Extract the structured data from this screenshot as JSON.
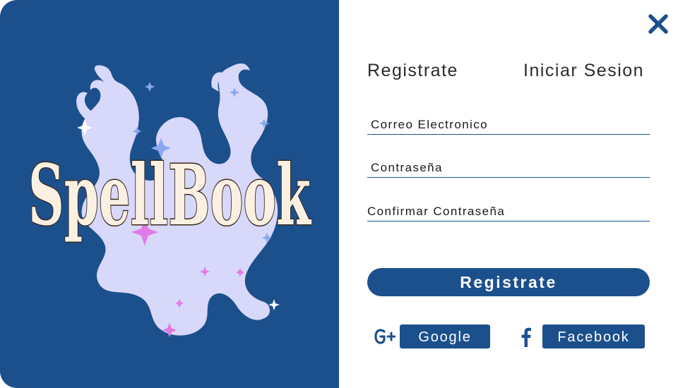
{
  "brand": {
    "logo_text": "SpellBook",
    "panel_color": "#1c508c",
    "logo_color": "#fbf1e3",
    "smoke_color": "#d8d8fa",
    "sparkle_colors": [
      "#ffffff",
      "#8aa8f0",
      "#e07ae8"
    ]
  },
  "header": {
    "close_icon": "close-icon"
  },
  "tabs": [
    {
      "label": "Registrate"
    },
    {
      "label": "Iniciar Sesion"
    }
  ],
  "form": {
    "email_placeholder": "Correo Electronico",
    "password_placeholder": "Contraseña",
    "confirm_password_placeholder": "Confirmar Contraseña",
    "submit_label": "Registrate"
  },
  "social": {
    "google_icon": "google-plus-icon",
    "google_label": "Google",
    "facebook_icon": "facebook-icon",
    "facebook_label": "Facebook"
  }
}
